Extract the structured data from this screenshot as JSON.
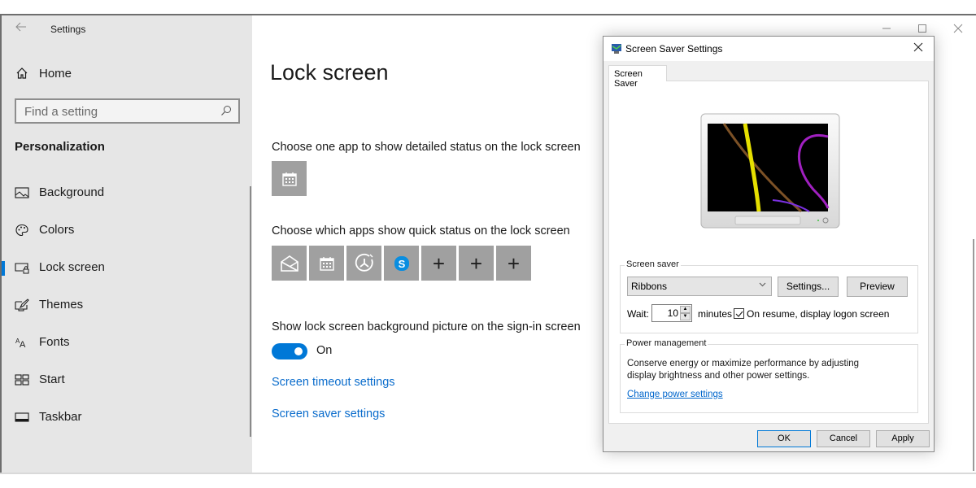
{
  "settings_window": {
    "title": "Settings",
    "caption_buttons": {
      "minimize": "—",
      "maximize": "☐",
      "close": "✕"
    },
    "sidebar": {
      "home_label": "Home",
      "search_placeholder": "Find a setting",
      "section_header": "Personalization",
      "items": [
        {
          "label": "Background",
          "icon": "picture-icon",
          "active": false
        },
        {
          "label": "Colors",
          "icon": "palette-icon",
          "active": false
        },
        {
          "label": "Lock screen",
          "icon": "lock-screen-icon",
          "active": true
        },
        {
          "label": "Themes",
          "icon": "themes-icon",
          "active": false
        },
        {
          "label": "Fonts",
          "icon": "fonts-icon",
          "active": false
        },
        {
          "label": "Start",
          "icon": "start-icon",
          "active": false
        },
        {
          "label": "Taskbar",
          "icon": "taskbar-icon",
          "active": false
        }
      ]
    },
    "main": {
      "page_title": "Lock screen",
      "detailed_status_label": "Choose one app to show detailed status on the lock screen",
      "detailed_status_app": "calendar-icon",
      "quick_status_label": "Choose which apps show quick status on the lock screen",
      "quick_status_apps": [
        "mail-icon",
        "calendar-icon",
        "alarms-icon",
        "skype-icon",
        "add",
        "add",
        "add"
      ],
      "plus_glyph": "+",
      "signin_bg_label": "Show lock screen background picture on the sign-in screen",
      "signin_bg_toggle": {
        "state": "On",
        "on": true
      },
      "links": {
        "screen_timeout": "Screen timeout settings",
        "screen_saver": "Screen saver settings"
      }
    }
  },
  "screen_saver_dialog": {
    "title": "Screen Saver Settings",
    "close_glyph": "✕",
    "tab": "Screen Saver",
    "screen_saver_group": {
      "legend": "Screen saver",
      "selected": "Ribbons",
      "settings_button": "Settings...",
      "preview_button": "Preview",
      "wait_label": "Wait:",
      "wait_value": "10",
      "minutes_label": "minutes",
      "resume_checkbox": {
        "label": "On resume, display logon screen",
        "checked": true
      }
    },
    "power_group": {
      "legend": "Power management",
      "description": "Conserve energy or maximize performance by adjusting display brightness and other power settings.",
      "link": "Change power settings"
    },
    "buttons": {
      "ok": "OK",
      "cancel": "Cancel",
      "apply": "Apply"
    },
    "colors": {
      "accent": "#0078d7",
      "link": "#0066cc"
    }
  }
}
